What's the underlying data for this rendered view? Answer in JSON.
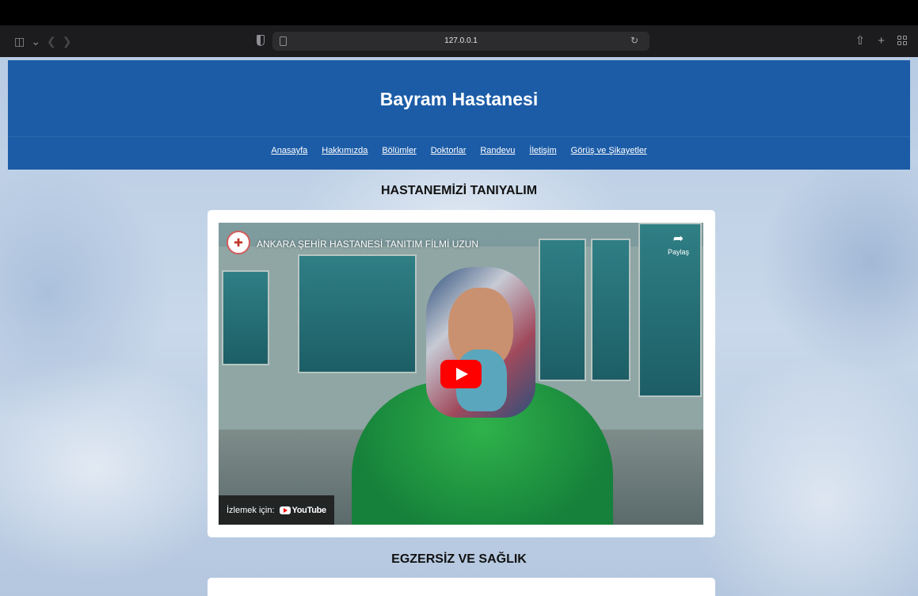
{
  "browser": {
    "url": "127.0.0.1"
  },
  "site": {
    "title": "Bayram Hastanesi",
    "nav": [
      "Anasayfa",
      "Hakkımızda",
      "Bölümler",
      "Doktorlar",
      "Randevu",
      "İletişim",
      "Görüş ve Şikayetler"
    ]
  },
  "sections": {
    "first_title": "HASTANEMİZİ TANIYALIM",
    "second_title": "EGZERSİZ VE SAĞLIK"
  },
  "video": {
    "title": "ANKARA ŞEHİR HASTANESİ TANITIM FİLMİ UZUN",
    "share_label": "Paylaş",
    "watch_on": "İzlemek için:",
    "platform": "YouTube"
  }
}
